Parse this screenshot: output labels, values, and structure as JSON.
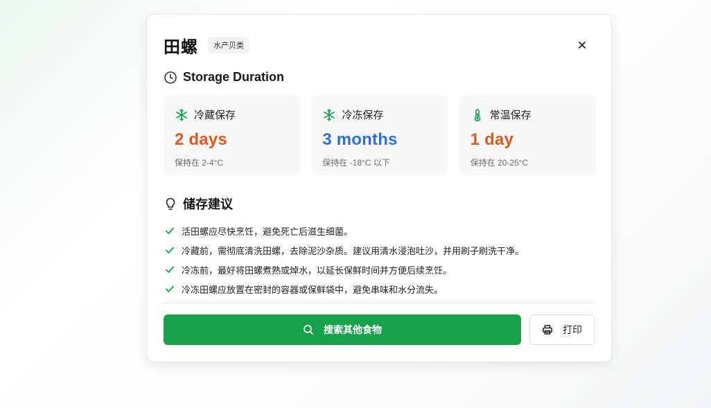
{
  "dialog": {
    "title": "田螺",
    "category": "水产贝类",
    "close_label": "×"
  },
  "storage": {
    "section_title": "Storage Duration",
    "items": [
      {
        "icon": "snowflake-icon",
        "label": "冷藏保存",
        "value": "2 days",
        "note": "保持在 2-4°C",
        "color": "#e2571a"
      },
      {
        "icon": "snowflake-icon",
        "label": "冷冻保存",
        "value": "3 months",
        "note": "保持在 -18°C 以下",
        "color": "#2f6fd6"
      },
      {
        "icon": "thermometer-icon",
        "label": "常温保存",
        "value": "1 day",
        "note": "保持在 20-25°C",
        "color": "#e2571a"
      }
    ]
  },
  "tips": {
    "section_title": "储存建议",
    "items": [
      "活田螺应尽快烹饪，避免死亡后滋生细菌。",
      "冷藏前，需彻底清洗田螺，去除泥沙杂质。建议用清水浸泡吐沙，并用刷子刷洗干净。",
      "冷冻前，最好将田螺煮熟或焯水，以延长保鲜时间并方便后续烹饪。",
      "冷冻田螺应放置在密封的容器或保鲜袋中，避免串味和水分流失。"
    ]
  },
  "actions": {
    "search_label": "搜索其他食物",
    "print_label": "打印"
  },
  "colors": {
    "accent": "#18a14b",
    "orange": "#e2571a",
    "blue": "#2f6fd6"
  }
}
